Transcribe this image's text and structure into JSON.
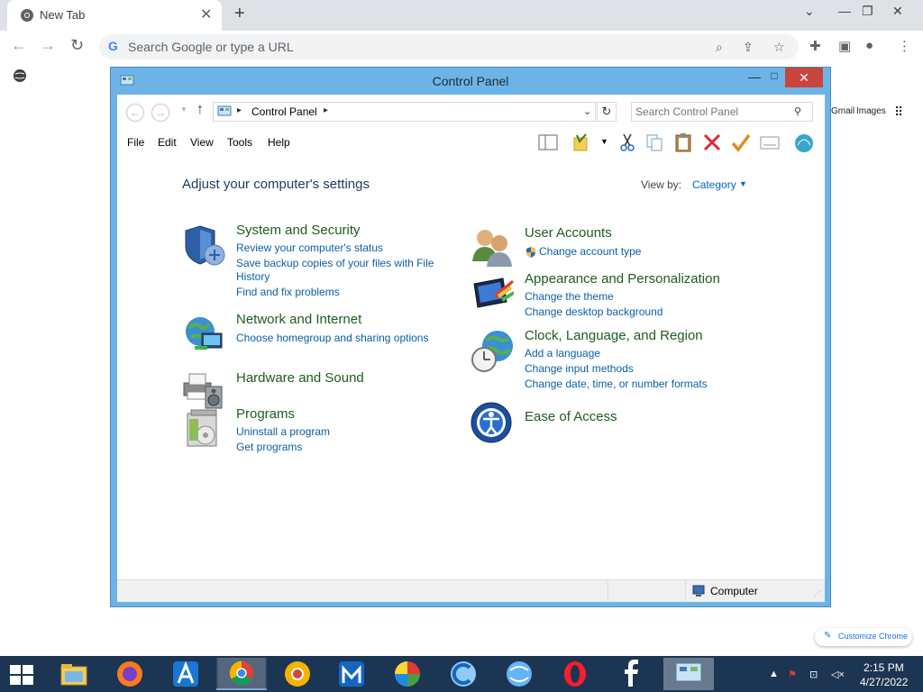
{
  "browser": {
    "tab_title": "New Tab",
    "tab_close": "✕",
    "new_tab": "+",
    "omnibox_placeholder": "Search Google or type a URL",
    "ntp_links": [
      "Gmail",
      "Images"
    ]
  },
  "customize": {
    "label": "Customize Chrome"
  },
  "window": {
    "title": "Control Panel",
    "close": "✕",
    "minimize": "—",
    "maximize": "□"
  },
  "address": {
    "crumb": "Control Panel",
    "search_placeholder": "Search Control Panel"
  },
  "menu": [
    "File",
    "Edit",
    "View",
    "Tools",
    "Help"
  ],
  "content": {
    "heading": "Adjust your computer's settings",
    "view_by_label": "View by:",
    "view_by_value": "Category"
  },
  "categories": {
    "system": {
      "title": "System and Security",
      "links": [
        "Review your computer's status",
        "Save backup copies of your files with File",
        "History",
        "Find and fix problems"
      ]
    },
    "network": {
      "title": "Network and Internet",
      "links": [
        "Choose homegroup and sharing options"
      ]
    },
    "hardware": {
      "title": "Hardware and Sound"
    },
    "programs": {
      "title": "Programs",
      "links": [
        "Uninstall a program",
        "Get programs"
      ]
    },
    "users": {
      "title": "User Accounts",
      "links": [
        "Change account type"
      ]
    },
    "appearance": {
      "title": "Appearance and Personalization",
      "links": [
        "Change the theme",
        "Change desktop background"
      ]
    },
    "clock": {
      "title": "Clock, Language, and Region",
      "links": [
        "Add a language",
        "Change input methods",
        "Change date, time, or number formats"
      ]
    },
    "ease": {
      "title": "Ease of Access"
    }
  },
  "statusbar": {
    "location": "Computer"
  },
  "taskbar": {
    "time": "2:15 PM",
    "date": "4/27/2022",
    "apps": [
      "file-explorer",
      "firefox",
      "app-a",
      "chrome",
      "chrome-alt",
      "maxthon",
      "browser-color",
      "ccleaner",
      "globe-browser",
      "opera",
      "facebook",
      "control-panel"
    ]
  },
  "colors": {
    "window_frame": "#6cb4e8",
    "taskbar": "#1c3552",
    "category_title": "#1e5c1e",
    "link": "#0a5fa8",
    "close_button": "#c7453a"
  }
}
